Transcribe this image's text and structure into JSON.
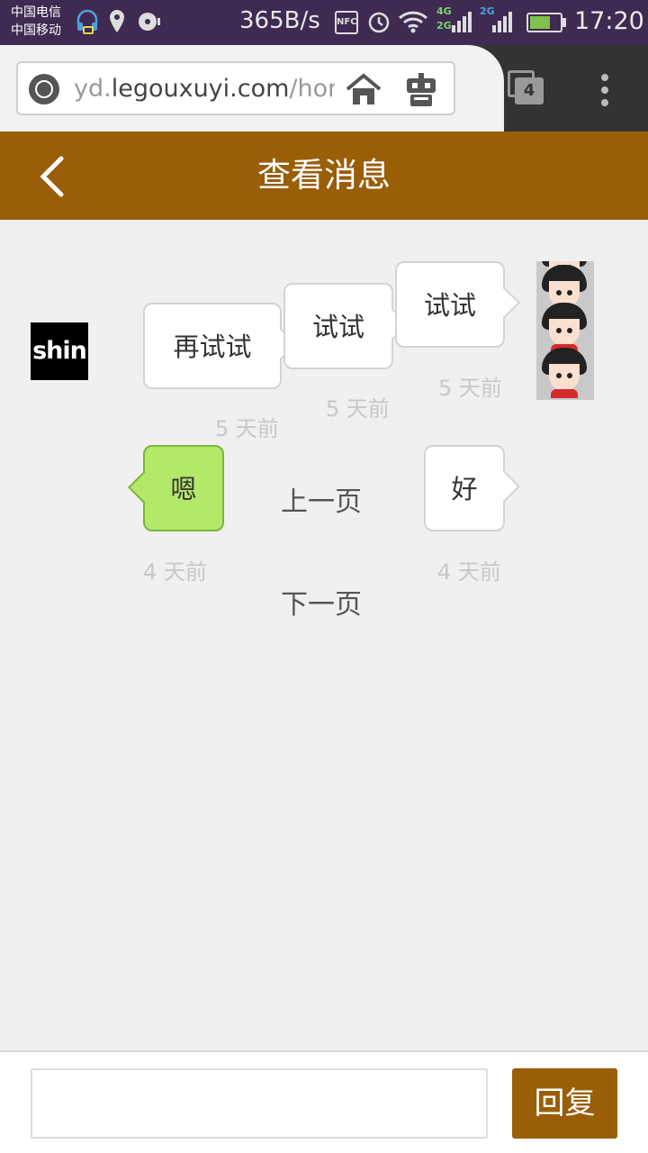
{
  "status_bar": {
    "carrier_1": "中国电信",
    "carrier_2": "中国移动",
    "net_speed": "365B/s",
    "nfc": "NFC",
    "net_4g": "4G",
    "net_2g_a": "2G",
    "net_2g_b": "2G",
    "time": "17:20"
  },
  "browser": {
    "url_prefix": "yd.",
    "url_domain": "legouxuyi.com",
    "url_suffix": "/hom",
    "tab_count": "4"
  },
  "header": {
    "title": "查看消息",
    "color": "#9a5e07"
  },
  "messages": [
    {
      "text": "再试试",
      "time": "5 天前",
      "side": "left"
    },
    {
      "text": "试试",
      "time": "5 天前",
      "side": "right"
    },
    {
      "text": "试试",
      "time": "5 天前",
      "side": "right"
    },
    {
      "text": "嗯",
      "time": "4 天前",
      "side": "left"
    },
    {
      "text": "好",
      "time": "4 天前",
      "side": "right"
    }
  ],
  "avatars": {
    "left_label": "shin"
  },
  "pager": {
    "prev": "上一页",
    "next": "下一页"
  },
  "reply": {
    "placeholder": "",
    "button": "回复"
  }
}
